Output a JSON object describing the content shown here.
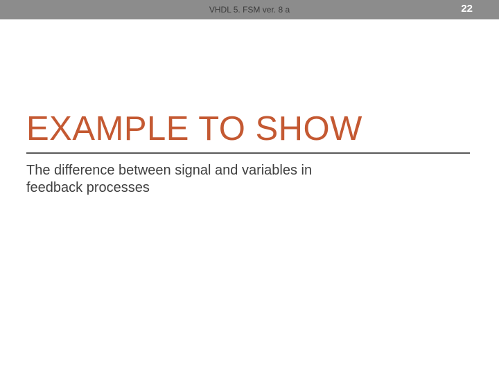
{
  "header": {
    "title": "VHDL 5. FSM ver. 8 a",
    "page_number": "22"
  },
  "slide": {
    "title": "EXAMPLE TO SHOW",
    "subtitle": "The difference between signal and variables in feedback processes"
  }
}
